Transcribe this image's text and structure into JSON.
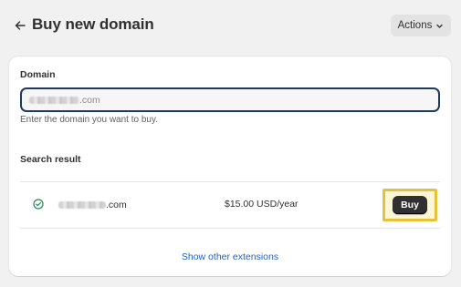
{
  "header": {
    "title": "Buy new domain",
    "actions_label": "Actions",
    "icons": {
      "back": "arrow-left-icon",
      "actions": "chevron-down-icon"
    }
  },
  "form": {
    "domain_label": "Domain",
    "domain_value_suffix": ".com",
    "help_text": "Enter the domain you want to buy."
  },
  "results": {
    "label": "Search result",
    "items": [
      {
        "domain_suffix": ".com",
        "price": "$15.00 USD/year",
        "buy_label": "Buy",
        "status_icon": "check-circle-icon"
      }
    ],
    "show_more_label": "Show other extensions"
  },
  "colors": {
    "background": "#f1f1f1",
    "card": "#ffffff",
    "input_border": "#1f3a5f",
    "primary_button": "#303030",
    "link": "#2463bc",
    "success": "#29845a",
    "highlight": "#e6c23a"
  }
}
